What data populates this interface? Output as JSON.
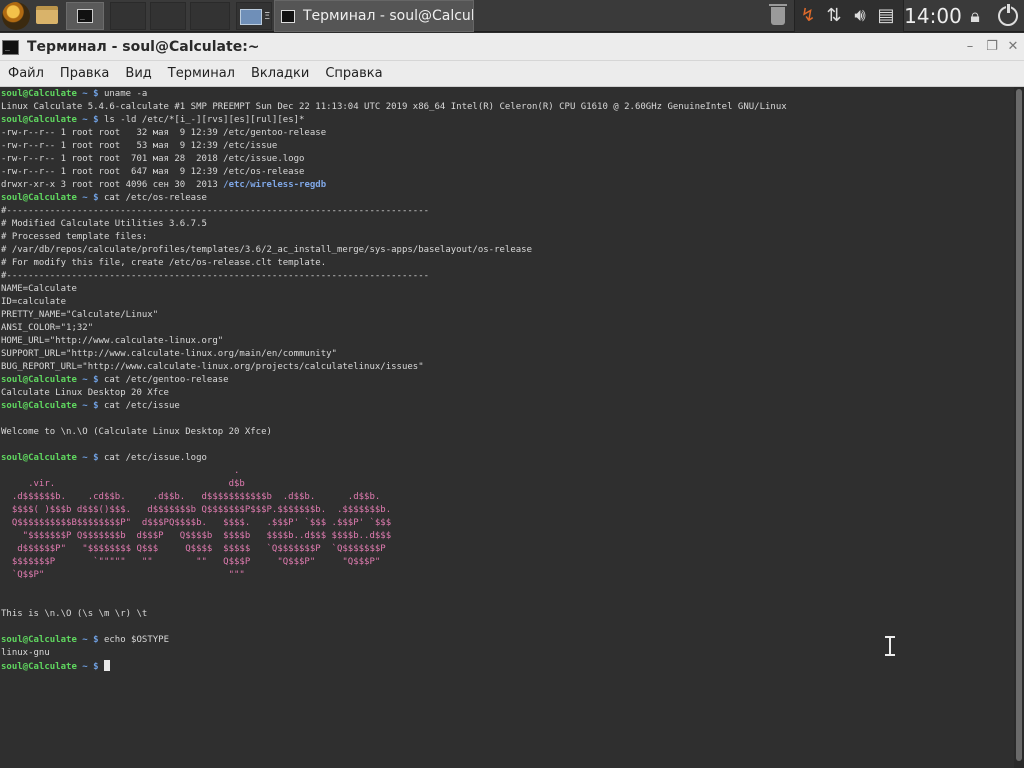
{
  "panel": {
    "launcher_icon": "calculate-linux-logo",
    "taskbar_window_title": "Терминал - soul@Calculat...",
    "ws4_suffix": "Ξ",
    "clock": "14:00"
  },
  "window": {
    "title": "Терминал - soul@Calculate:~",
    "minimize_glyph": "–",
    "maximize_glyph": "❐",
    "close_glyph": "✕"
  },
  "menu": [
    "Файл",
    "Правка",
    "Вид",
    "Терминал",
    "Вкладки",
    "Справка"
  ],
  "terminal": {
    "prompt_user": "soul@Calculate",
    "prompt_tail": "~ $",
    "lines": [
      {
        "t": "cmd",
        "text": "uname -a"
      },
      {
        "t": "out",
        "text": "Linux Calculate 5.4.6-calculate #1 SMP PREEMPT Sun Dec 22 11:13:04 UTC 2019 x86_64 Intel(R) Celeron(R) CPU G1610 @ 2.60GHz GenuineIntel GNU/Linux"
      },
      {
        "t": "cmd",
        "text": "ls -ld /etc/*[i_-][rvs][es][rul][es]*"
      },
      {
        "t": "out",
        "text": "-rw-r--r-- 1 root root   32 мая  9 12:39 /etc/gentoo-release"
      },
      {
        "t": "out",
        "text": "-rw-r--r-- 1 root root   53 мая  9 12:39 /etc/issue"
      },
      {
        "t": "out",
        "text": "-rw-r--r-- 1 root root  701 мая 28  2018 /etc/issue.logo"
      },
      {
        "t": "out",
        "text": "-rw-r--r-- 1 root root  647 мая  9 12:39 /etc/os-release"
      },
      {
        "t": "link",
        "text": "drwxr-xr-x 3 root root 4096 сен 30  2013 ",
        "link": "/etc/wireless-regdb"
      },
      {
        "t": "cmd",
        "text": "cat /etc/os-release"
      },
      {
        "t": "out",
        "text": "#------------------------------------------------------------------------------"
      },
      {
        "t": "out",
        "text": "# Modified Calculate Utilities 3.6.7.5"
      },
      {
        "t": "out",
        "text": "# Processed template files:"
      },
      {
        "t": "out",
        "text": "# /var/db/repos/calculate/profiles/templates/3.6/2_ac_install_merge/sys-apps/baselayout/os-release"
      },
      {
        "t": "out",
        "text": "# For modify this file, create /etc/os-release.clt template."
      },
      {
        "t": "out",
        "text": "#------------------------------------------------------------------------------"
      },
      {
        "t": "out",
        "text": "NAME=Calculate"
      },
      {
        "t": "out",
        "text": "ID=calculate"
      },
      {
        "t": "out",
        "text": "PRETTY_NAME=\"Calculate/Linux\""
      },
      {
        "t": "out",
        "text": "ANSI_COLOR=\"1;32\""
      },
      {
        "t": "out",
        "text": "HOME_URL=\"http://www.calculate-linux.org\""
      },
      {
        "t": "out",
        "text": "SUPPORT_URL=\"http://www.calculate-linux.org/main/en/community\""
      },
      {
        "t": "out",
        "text": "BUG_REPORT_URL=\"http://www.calculate-linux.org/projects/calculatelinux/issues\""
      },
      {
        "t": "cmd",
        "text": "cat /etc/gentoo-release"
      },
      {
        "t": "out",
        "text": "Calculate Linux Desktop 20 Xfce"
      },
      {
        "t": "cmd",
        "text": "cat /etc/issue"
      },
      {
        "t": "out",
        "text": ""
      },
      {
        "t": "out",
        "text": "Welcome to \\n.\\O (Calculate Linux Desktop 20 Xfce)"
      },
      {
        "t": "out",
        "text": ""
      },
      {
        "t": "cmd",
        "text": "cat /etc/issue.logo"
      },
      {
        "t": "logo",
        "text": "                                           ."
      },
      {
        "t": "logo",
        "text": "     .vir.                                d$b"
      },
      {
        "t": "logo",
        "text": "  .d$$$$$$b.    .cd$$b.     .d$$b.   d$$$$$$$$$$$b  .d$$b.      .d$$b."
      },
      {
        "t": "logo",
        "text": "  $$$$( )$$$b d$$$()$$$.   d$$$$$$$b Q$$$$$$$P$$$P.$$$$$$$b.  .$$$$$$$b."
      },
      {
        "t": "logo",
        "text": "  Q$$$$$$$$$$B$$$$$$$$P\"  d$$$PQ$$$$b.   $$$$.   .$$$P' `$$$ .$$$P' `$$$"
      },
      {
        "t": "logo",
        "text": "    \"$$$$$$$P Q$$$$$$$b  d$$$P   Q$$$$b  $$$$b   $$$$b..d$$$ $$$$b..d$$$"
      },
      {
        "t": "logo",
        "text": "   d$$$$$$P\"   \"$$$$$$$$ Q$$$     Q$$$$  $$$$$   `Q$$$$$$$P  `Q$$$$$$$P"
      },
      {
        "t": "logo",
        "text": "  $$$$$$$P       `\"\"\"\"\"   \"\"        \"\"   Q$$$P     \"Q$$$P\"     \"Q$$$P\""
      },
      {
        "t": "logo",
        "text": "  `Q$$P\"                                  \"\"\""
      },
      {
        "t": "out",
        "text": ""
      },
      {
        "t": "out",
        "text": ""
      },
      {
        "t": "out",
        "text": "This is \\n.\\O (\\s \\m \\r) \\t"
      },
      {
        "t": "out",
        "text": ""
      },
      {
        "t": "cmd",
        "text": "echo $OSTYPE"
      },
      {
        "t": "out",
        "text": "linux-gnu"
      },
      {
        "t": "cmd_cursor",
        "text": ""
      }
    ]
  }
}
